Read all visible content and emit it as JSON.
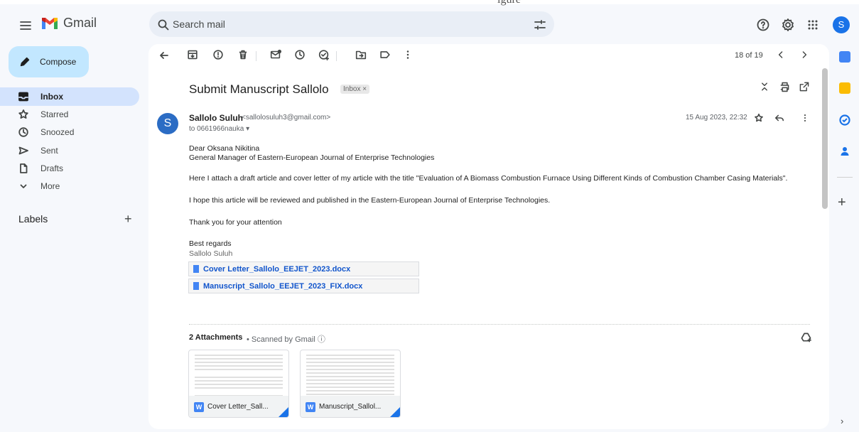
{
  "artifact": {
    "top_text": "igure"
  },
  "app": {
    "name": "Gmail"
  },
  "search": {
    "placeholder": "Search mail"
  },
  "account": {
    "initial": "S"
  },
  "compose": {
    "label": "Compose"
  },
  "sidebar": {
    "items": [
      {
        "label": "Inbox",
        "icon": "inbox-icon",
        "active": true
      },
      {
        "label": "Starred",
        "icon": "star-icon"
      },
      {
        "label": "Snoozed",
        "icon": "clock-icon"
      },
      {
        "label": "Sent",
        "icon": "send-icon"
      },
      {
        "label": "Drafts",
        "icon": "draft-icon"
      },
      {
        "label": "More",
        "icon": "chevron-down-icon"
      }
    ],
    "labels_title": "Labels",
    "labels_add": "+"
  },
  "toolbar": {
    "count": "18 of 19",
    "icons": [
      "back-icon",
      "archive-icon",
      "report-spam-icon",
      "delete-icon",
      "mark-unread-icon",
      "snooze-icon",
      "add-task-icon",
      "move-to-icon",
      "label-icon",
      "more-icon",
      "newer-icon",
      "older-icon"
    ]
  },
  "message": {
    "subject": "Submit Manuscript Sallolo",
    "label_chip": "Inbox ×",
    "sender_initial": "S",
    "sender_name": "Sallolo Suluh",
    "sender_email": "<sallolosuluh3@gmail.com>",
    "recipient": "to 0661966nauka ▾",
    "date": "15 Aug 2023, 22:32",
    "body": {
      "greeting": "Dear Oksana Nikitina",
      "role": "General Manager of Eastern-European  Journal of Enterprise Technologies",
      "para1": "Here I attach a draft article and cover letter of my article with the title \"Evaluation of A Biomass Combustion Furnace Using Different Kinds of Combustion Chamber Casing Materials\".",
      "para2": "I hope this article will be reviewed and published in the Eastern-European Journal of Enterprise Technologies.",
      "para3": "Thank you for your attention",
      "closing": "Best regards",
      "signature": "Sallolo Suluh"
    },
    "inline_attachments": [
      "Cover Letter_Sallolo_EEJET_2023.docx",
      "Manuscript_Sallolo_EEJET_2023_FIX.docx"
    ]
  },
  "attachments": {
    "count_label": "2 Attachments",
    "scanned_label": "• Scanned by Gmail ⓘ",
    "files": [
      {
        "name": "Cover Letter_Sall...",
        "type_letter": "W"
      },
      {
        "name": "Manuscript_Sallol...",
        "type_letter": "W"
      }
    ]
  },
  "right_rail": {
    "apps": [
      {
        "icon": "calendar-icon",
        "color": "#4285f4"
      },
      {
        "icon": "keep-icon",
        "color": "#fbbc04"
      },
      {
        "icon": "tasks-icon",
        "color": "#1a73e8"
      },
      {
        "icon": "contacts-icon",
        "color": "#1a73e8"
      }
    ],
    "add": "+",
    "expand": "›"
  },
  "colors": {
    "accent": "#0b57d0",
    "compose_bg": "#c2e7ff",
    "active_nav": "#d3e3fd",
    "app_bg": "#f6f8fc"
  }
}
